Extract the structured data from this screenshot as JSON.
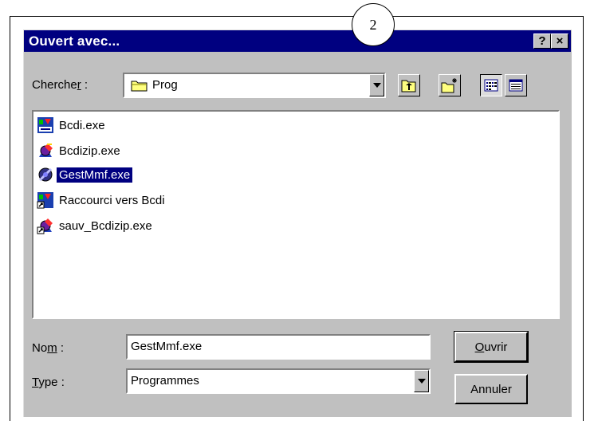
{
  "annotation": {
    "step_number": "2"
  },
  "dialog": {
    "title": "Ouvert avec...",
    "help_glyph": "?",
    "close_glyph": "×"
  },
  "lookin": {
    "label_pre": "Cherche",
    "label_key": "r",
    "label_post": " :",
    "folder_icon": "folder-icon",
    "value": "Prog"
  },
  "toolbar": {
    "buttons": [
      "up-folder-icon",
      "new-folder-icon",
      "list-view-icon",
      "details-view-icon"
    ]
  },
  "files": [
    {
      "name": "Bcdi.exe",
      "icon": "bcdi-app-icon"
    },
    {
      "name": "Bcdizip.exe",
      "icon": "bcdizip-app-icon"
    },
    {
      "name": "GestMmf.exe",
      "icon": "gestmmf-app-icon",
      "selected": true
    },
    {
      "name": "Raccourci vers Bcdi",
      "icon": "bcdi-shortcut-icon"
    },
    {
      "name": "sauv_Bcdizip.exe",
      "icon": "bcdizip-shortcut-icon"
    }
  ],
  "name_field": {
    "label_pre": "No",
    "label_key": "m",
    "label_post": " :",
    "value": "GestMmf.exe"
  },
  "type_field": {
    "label_key": "T",
    "label_post": "ype :",
    "value": "Programmes"
  },
  "buttons": {
    "open_key": "O",
    "open_rest": "uvrir",
    "cancel": "Annuler"
  },
  "colors": {
    "titlebar": "#000080",
    "dialog_face": "#c0c0c0",
    "selection": "#000080"
  }
}
